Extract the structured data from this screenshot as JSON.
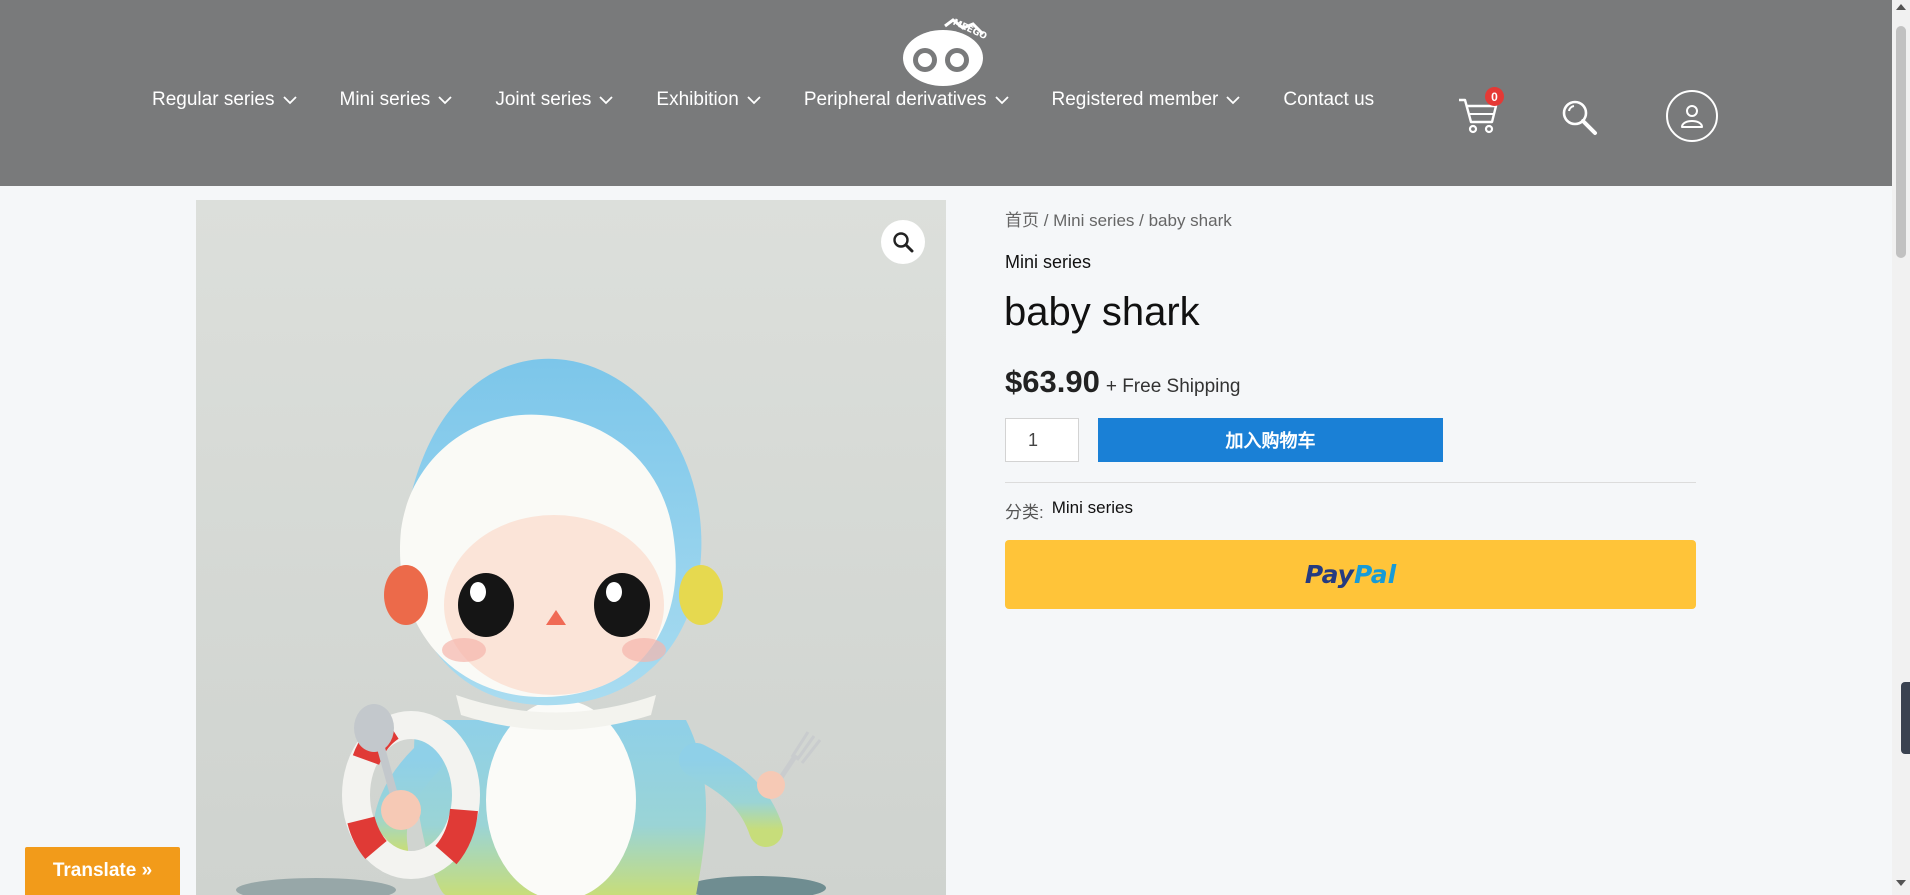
{
  "header": {
    "logo_text": "MEEGO",
    "nav": [
      {
        "label": "Regular series",
        "has_dropdown": true
      },
      {
        "label": "Mini series",
        "has_dropdown": true
      },
      {
        "label": "Joint series",
        "has_dropdown": true
      },
      {
        "label": "Exhibition",
        "has_dropdown": true
      },
      {
        "label": "Peripheral derivatives",
        "has_dropdown": true
      },
      {
        "label": "Registered member",
        "has_dropdown": true
      },
      {
        "label": "Contact us",
        "has_dropdown": false
      }
    ],
    "cart_count": "0",
    "icons": [
      "cart-icon",
      "search-icon",
      "user-icon"
    ]
  },
  "breadcrumb": {
    "home": "首页",
    "separator": " / ",
    "category": "Mini series",
    "current": "baby shark"
  },
  "product": {
    "category": "Mini series",
    "title": "baby shark",
    "price": "$63.90",
    "shipping": "+ Free Shipping",
    "quantity": "1",
    "add_to_cart_label": "加入购物车",
    "meta_label": "分类:",
    "meta_value": "Mini series"
  },
  "paypal": {
    "pay": "Pay",
    "pal": "Pal"
  },
  "translate_label": "Translate »",
  "colors": {
    "header_bg": "#797a7b",
    "add_cart": "#1a80d6",
    "paypal": "#ffc439",
    "translate": "#f29b1a",
    "badge": "#e53935"
  }
}
